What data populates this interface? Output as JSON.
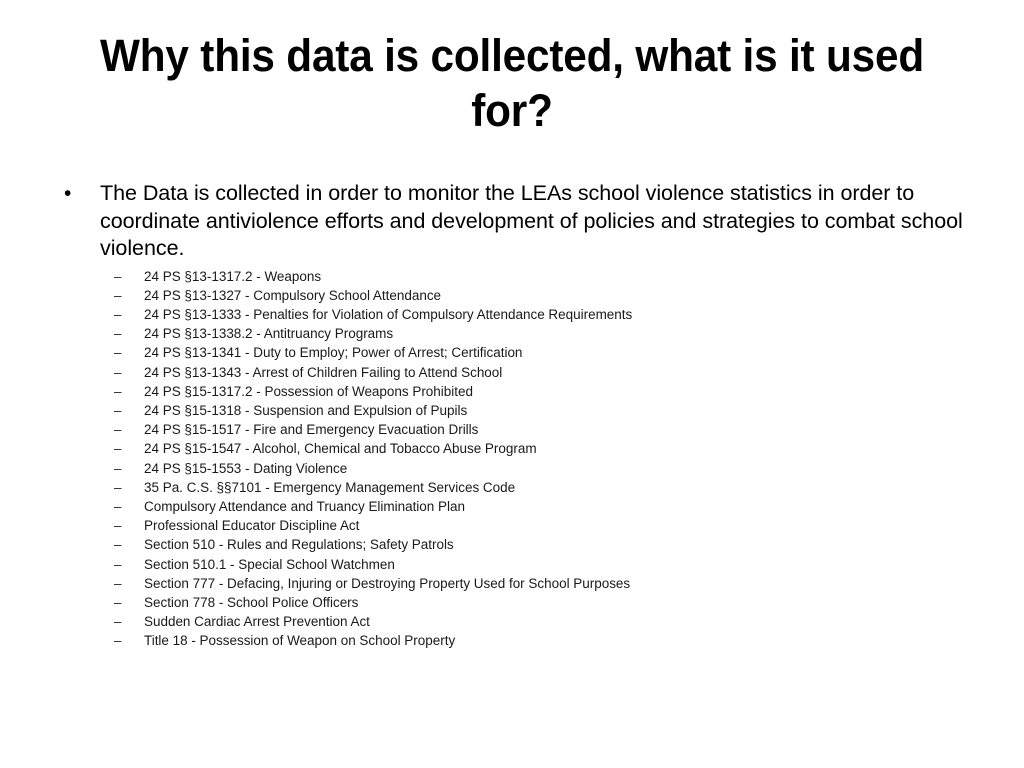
{
  "slide": {
    "title": "Why this data is collected, what is it used for?",
    "background_color": "#ffffff",
    "text_color": "#000000",
    "main_bullet": {
      "marker": "•",
      "text": "The Data is collected in order to monitor the LEAs school violence statistics in order to coordinate antiviolence efforts and development of policies and strategies to combat school violence."
    },
    "sub_bullet_marker": "–",
    "sub_bullets": [
      "24 PS §13-1317.2 - Weapons",
      "24 PS §13-1327 - Compulsory School Attendance",
      "24 PS §13-1333 - Penalties for Violation of Compulsory Attendance Requirements",
      "24 PS §13-1338.2 - Antitruancy Programs",
      "24 PS §13-1341 - Duty to Employ; Power of Arrest; Certification",
      "24 PS §13-1343 - Arrest of Children Failing to Attend School",
      "24 PS §15-1317.2 - Possession of Weapons Prohibited",
      "24 PS §15-1318 - Suspension and Expulsion of Pupils",
      "24 PS §15-1517 - Fire and Emergency Evacuation Drills",
      "24 PS §15-1547 - Alcohol, Chemical and Tobacco Abuse Program",
      "24 PS §15-1553 - Dating Violence",
      "35 Pa. C.S. §§7101 - Emergency Management Services Code",
      "Compulsory Attendance and Truancy Elimination Plan",
      "Professional Educator Discipline Act",
      "Section 510 - Rules and Regulations; Safety Patrols",
      "Section 510.1 - Special School Watchmen",
      "Section 777 - Defacing, Injuring or Destroying Property Used for School Purposes",
      "Section 778 - School Police Officers",
      "Sudden Cardiac Arrest Prevention Act",
      "Title 18 - Possession of Weapon on School Property"
    ]
  }
}
